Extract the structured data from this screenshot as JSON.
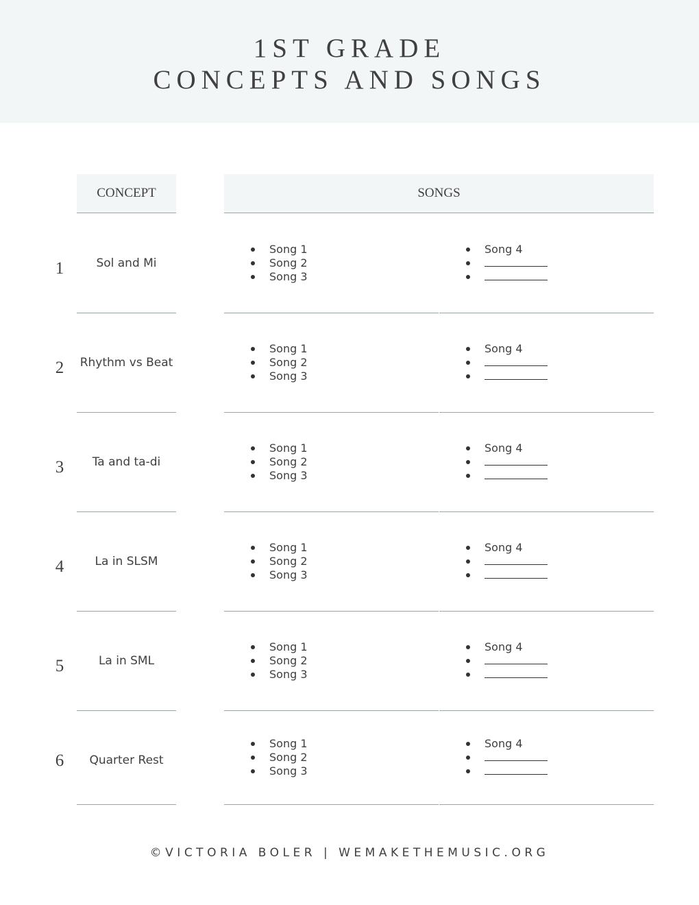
{
  "title": {
    "line1": "1ST GRADE",
    "line2": "CONCEPTS AND SONGS"
  },
  "headers": {
    "concept": "CONCEPT",
    "songs": "SONGS"
  },
  "rows": [
    {
      "number": "1",
      "concept": "Sol and Mi",
      "songs_left": [
        "Song 1",
        "Song 2",
        "Song 3"
      ],
      "songs_right": [
        "Song 4"
      ]
    },
    {
      "number": "2",
      "concept": "Rhythm vs Beat",
      "songs_left": [
        "Song 1",
        "Song 2",
        "Song 3"
      ],
      "songs_right": [
        "Song 4"
      ]
    },
    {
      "number": "3",
      "concept": "Ta and ta-di",
      "songs_left": [
        "Song 1",
        "Song 2",
        "Song 3"
      ],
      "songs_right": [
        "Song 4"
      ]
    },
    {
      "number": "4",
      "concept": "La in SLSM",
      "songs_left": [
        "Song 1",
        "Song 2",
        "Song 3"
      ],
      "songs_right": [
        "Song 4"
      ]
    },
    {
      "number": "5",
      "concept": "La in SML",
      "songs_left": [
        "Song 1",
        "Song 2",
        "Song 3"
      ],
      "songs_right": [
        "Song 4"
      ]
    },
    {
      "number": "6",
      "concept": "Quarter Rest",
      "songs_left": [
        "Song 1",
        "Song 2",
        "Song 3"
      ],
      "songs_right": [
        "Song 4"
      ]
    }
  ],
  "footer": "©VICTORIA BOLER | WEMAKETHEMUSIC.ORG"
}
